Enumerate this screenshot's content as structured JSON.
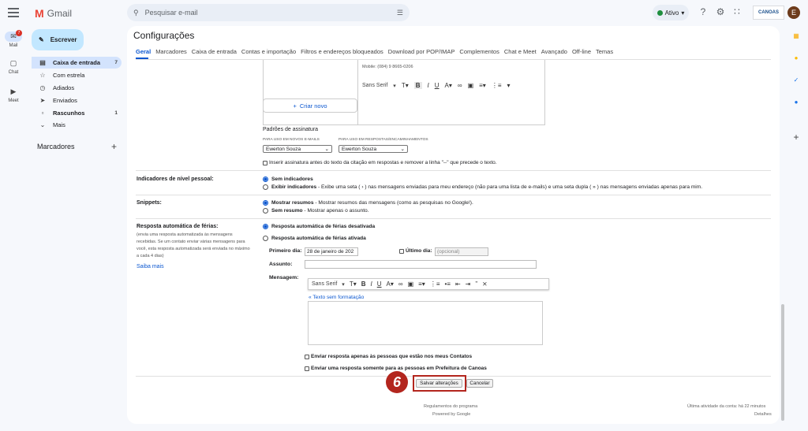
{
  "app": {
    "name": "Gmail"
  },
  "search": {
    "placeholder": "Pesquisar e-mail"
  },
  "status": {
    "label": "Ativo"
  },
  "org_logo": {
    "text": "CANOAS"
  },
  "avatar": {
    "initial": "E"
  },
  "rail": [
    {
      "label": "Mail",
      "icon": "mail-icon",
      "badge": "7"
    },
    {
      "label": "Chat",
      "icon": "chat-icon"
    },
    {
      "label": "Meet",
      "icon": "video-icon"
    }
  ],
  "compose": {
    "label": "Escrever"
  },
  "nav": [
    {
      "label": "Caixa de entrada",
      "icon": "inbox-icon",
      "count": "7",
      "bold": true
    },
    {
      "label": "Com estrela",
      "icon": "star-icon",
      "count": ""
    },
    {
      "label": "Adiados",
      "icon": "clock-icon",
      "count": ""
    },
    {
      "label": "Enviados",
      "icon": "send-icon",
      "count": ""
    },
    {
      "label": "Rascunhos",
      "icon": "draft-icon",
      "count": "1",
      "bold": true
    },
    {
      "label": "Mais",
      "icon": "chevron-down-icon",
      "count": ""
    }
  ],
  "labels": {
    "heading": "Marcadores"
  },
  "page": {
    "title": "Configurações"
  },
  "tabs": [
    "Geral",
    "Marcadores",
    "Caixa de entrada",
    "Contas e importação",
    "Filtros e endereços bloqueados",
    "Download por POP/IMAP",
    "Complementos",
    "Chat e Meet",
    "Avançado",
    "Off-line",
    "Temas"
  ],
  "signature": {
    "mobile": "Mobile: (084) 9 8665-0206",
    "font": "Sans Serif",
    "create_new": "Criar novo",
    "defaults_title": "Padrões de assinatura",
    "new_caption": "PARA USO EM NOVOS E-MAILS",
    "reply_caption": "PARA USO EM RESPOSTAS/ENCAMINHAMENTOS",
    "new_value": "Ewerton Souza",
    "reply_value": "Ewerton Souza",
    "insert_before": "Inserir assinatura antes do texto da citação em respostas e remover a linha \"--\" que precede o texto."
  },
  "indicators": {
    "label": "Indicadores de nível pessoal:",
    "opt1": "Sem indicadores",
    "opt2_bold": "Exibir indicadores",
    "opt2_rest": " - Exibe uma seta ( › ) nas mensagens enviadas para meu endereço (não para uma lista de e-mails) e uma seta dupla ( » ) nas mensagens enviadas apenas para mim."
  },
  "snippets": {
    "label": "Snippets:",
    "opt1_bold": "Mostrar resumos",
    "opt1_rest": " - Mostrar resumos das mensagens (como as pesquisas no Google!).",
    "opt2_bold": "Sem resumo",
    "opt2_rest": " - Mostrar apenas o assunto."
  },
  "vacation": {
    "label": "Resposta automática de férias:",
    "desc1": "(envia uma resposta automatizada às mensagens",
    "desc2": "recebidas. Se um contato enviar várias mensagens para",
    "desc3": "você, esta resposta automatizada será enviada no máximo",
    "desc4": "a cada 4 dias)",
    "learn_more": "Saiba mais",
    "off": "Resposta automática de férias desativada",
    "on": "Resposta automática de férias ativada",
    "first_day_label": "Primeiro dia:",
    "first_day_value": "28 de janeiro de 202",
    "last_day_label": "Último dia:",
    "last_day_placeholder": "(opcional)",
    "subject_label": "Assunto:",
    "message_label": "Mensagem:",
    "font": "Sans Serif",
    "plain_text": "« Texto sem formatação",
    "contacts_only": "Enviar resposta apenas às pessoas que estão nos meus Contatos",
    "org_only": "Enviar uma resposta somente para as pessoas em Prefeitura de Canoas"
  },
  "actions": {
    "save": "Salvar alterações",
    "cancel": "Cancelar",
    "step": "6"
  },
  "footer": {
    "terms": "Regulamentos do programa",
    "powered": "Powered by Google",
    "activity": "Última atividade da conta: há 22 minutos",
    "details": "Detalhes"
  },
  "colors": {
    "accent": "#0b57d0",
    "highlight": "#b3261e",
    "compose": "#c2e7ff"
  }
}
